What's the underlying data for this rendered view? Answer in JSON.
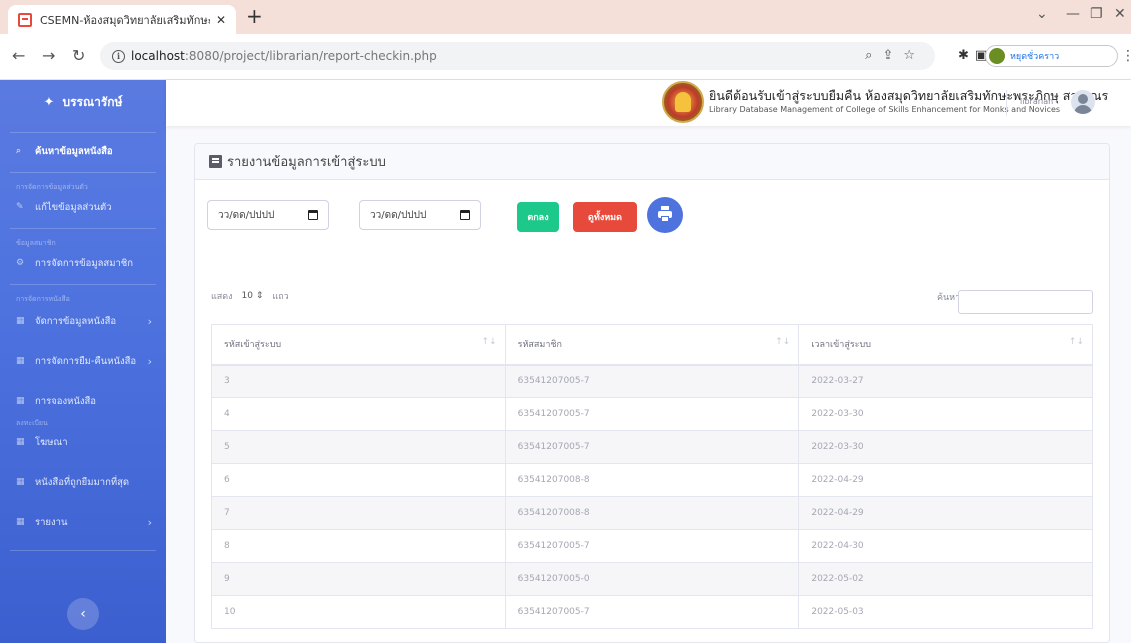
{
  "browser": {
    "tab_title": "CSEMN-ห้องสมุดวิทยาลัยเสริมทักษะ",
    "url_host": "localhost",
    "url_path": ":8080/project/librarian/report-checkin.php",
    "profile_name": "หยุดชั่วคราว"
  },
  "sidebar": {
    "brand": "บรรณารักษ์",
    "items": [
      {
        "label": "ค้นหาข้อมูลหนังสือ"
      },
      {
        "label": "แก้ไขข้อมูลส่วนตัว"
      },
      {
        "label": "การจัดการข้อมูลสมาชิก"
      },
      {
        "label": "จัดการข้อมูลหนังสือ"
      },
      {
        "label": "การจัดการยืม-คืนหนังสือ"
      },
      {
        "label": "การจองหนังสือ"
      },
      {
        "label": "โฆษณา"
      },
      {
        "label": "หนังสือที่ถูกยืมมากที่สุด"
      },
      {
        "label": "รายงาน"
      }
    ],
    "headings": [
      "การจัดการข้อมูลส่วนตัว",
      "ข้อมูลสมาชิก",
      "การจัดการหนังสือ",
      "ลงทะเบียน"
    ]
  },
  "topbar": {
    "org_th": "ยินดีต้อนรับเข้าสู่ระบบยืมคืน ห้องสมุดวิทยาลัยเสริมทักษะพระภิกษุ สามเณร",
    "org_en": "Library Database Management of College of Skills Enhancement for Monks and Novices",
    "role": "librarian"
  },
  "page": {
    "title": "รายงานข้อมูลการเข้าสู่ระบบ",
    "date_from_placeholder": "วว/ดด/ปปปป",
    "date_to_placeholder": "วว/ดด/ปปปป",
    "btn_ok": "ตกลง",
    "btn_all": "ดูทั้งหมด",
    "show_label": "แสดง",
    "page_length": "10",
    "entries_label": "แถว",
    "search_label": "ค้นหา:"
  },
  "table": {
    "columns": [
      "รหัสเข้าสู่ระบบ",
      "รหัสสมาชิก",
      "เวลาเข้าสู่ระบบ"
    ],
    "rows": [
      [
        "3",
        "63541207005-7",
        "2022-03-27"
      ],
      [
        "4",
        "63541207005-7",
        "2022-03-30"
      ],
      [
        "5",
        "63541207005-7",
        "2022-03-30"
      ],
      [
        "6",
        "63541207008-8",
        "2022-04-29"
      ],
      [
        "7",
        "63541207008-8",
        "2022-04-29"
      ],
      [
        "8",
        "63541207005-7",
        "2022-04-30"
      ],
      [
        "9",
        "63541207005-0",
        "2022-05-02"
      ],
      [
        "10",
        "63541207005-7",
        "2022-05-03"
      ]
    ]
  }
}
